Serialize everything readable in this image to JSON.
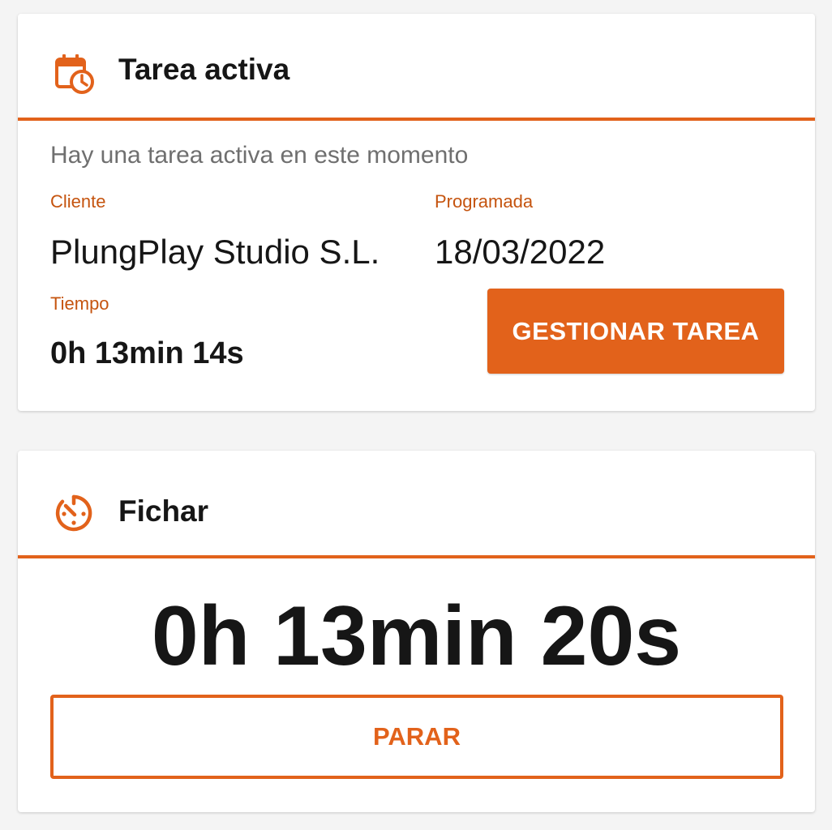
{
  "colors": {
    "accent": "#e2621b",
    "label": "#c5540f",
    "text": "#161616",
    "muted": "#6f6f6f"
  },
  "active_task": {
    "icon": "calendar-clock-icon",
    "title": "Tarea activa",
    "subtitle": "Hay una tarea activa en este momento",
    "client_label": "Cliente",
    "client_value": "PlungPlay Studio S.L.",
    "scheduled_label": "Programada",
    "scheduled_value": "18/03/2022",
    "time_label": "Tiempo",
    "time_value": "0h 13min 14s",
    "manage_button": "GESTIONAR TAREA"
  },
  "clock_in": {
    "icon": "timer-icon",
    "title": "Fichar",
    "elapsed": "0h 13min 20s",
    "stop_button": "PARAR"
  }
}
